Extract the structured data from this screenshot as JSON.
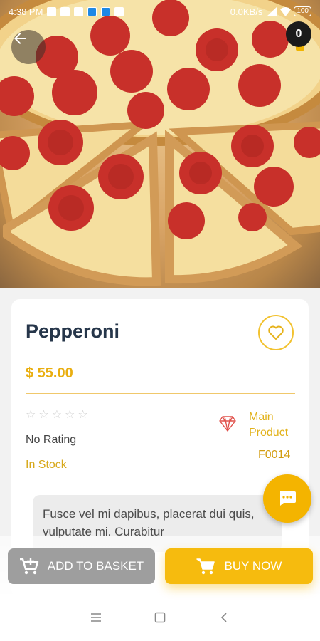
{
  "status_bar": {
    "time": "4:38 PM",
    "speed": "0.0KB/s",
    "battery": "100"
  },
  "product": {
    "name": "Pepperoni",
    "price": "$ 55.00",
    "rating_text": "No Rating",
    "rating_value": 0,
    "rating_max": 5,
    "stock": "In Stock",
    "type_line1": "Main",
    "type_line2": "Product",
    "code": "F0014",
    "description": "Fusce vel mi dapibus, placerat dui quis, vulputate mi. Curabitur"
  },
  "header": {
    "cart_count": "0"
  },
  "actions": {
    "add_to_basket": "ADD TO BASKET",
    "buy_now": "BUY NOW"
  },
  "colors": {
    "accent": "#F6BB0E",
    "title": "#26364A",
    "grey_button": "#9E9E9E"
  },
  "icons": {
    "back": "arrow-left-icon",
    "favorite": "heart-outline-icon",
    "product_type": "diamond-icon",
    "chat": "chat-bubble-icon",
    "add_basket": "cart-plus-icon",
    "buy": "cart-icon"
  }
}
